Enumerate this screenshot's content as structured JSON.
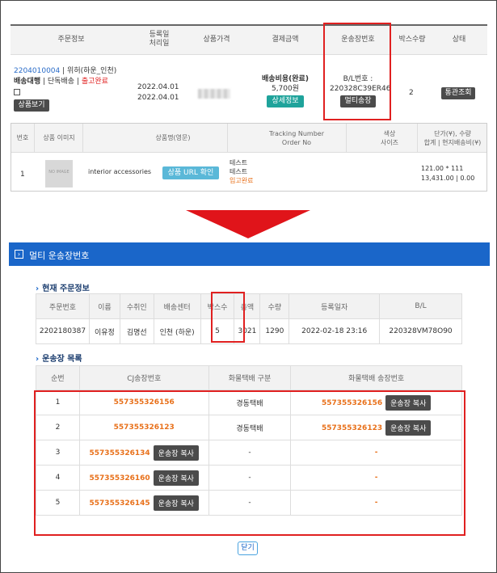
{
  "top_table": {
    "headers": [
      "주문정보",
      "등록일\n처리일",
      "상품가격",
      "결제금액",
      "운송장번호",
      "박스수량",
      "상태"
    ],
    "order": {
      "order_id": "2204010004",
      "order_name": "위허(하운_인천)",
      "agency": "배송대행",
      "single": "단독배송",
      "status_text": "출고완료",
      "view_button": "상품보기",
      "reg_date": "2022.04.01",
      "proc_date": "2022.04.01",
      "shipping_fee": "배송비용(완료)",
      "fee_amount": "5,700원",
      "detail_button": "상세정보",
      "bl_label": "B/L번호 :",
      "bl_number": "220328C39ER46",
      "multi_button": "멀티송장",
      "box_qty": "2",
      "customs_button": "통관조회"
    },
    "sub_headers": {
      "no": "번호",
      "image": "상품 이미지",
      "name": "상품명(영문)",
      "tracking": "Tracking Number\nOrder No",
      "color": "색상\n사이즈",
      "price": "단가(¥), 수량\n합계 | 현지배송비(¥)"
    },
    "item": {
      "no": "1",
      "thumb_text": "NO IMAGE",
      "name": "interior accessories",
      "url_button": "상품 URL 확인",
      "tracking1": "테스트",
      "tracking2": "테스트",
      "received": "입고완료",
      "price_line1": "121.00 * 111",
      "price_line2": "13,431.00 | 0.00"
    }
  },
  "modal": {
    "title": "멀티 운송장번호",
    "current_section": "현재 주문정보",
    "current_headers": [
      "주문번호",
      "이름",
      "수취인",
      "배송센터",
      "박스수",
      "총액",
      "수량",
      "등록일자",
      "B/L"
    ],
    "current_row": [
      "2202180387",
      "이유정",
      "김명선",
      "인천 (하운)",
      "5",
      "3021",
      "1290",
      "2022-02-18 23:16",
      "220328VM78O90"
    ],
    "list_section": "운송장 목록",
    "list_headers": [
      "순번",
      "CJ송장번호",
      "화물택배 구분",
      "화물택배 송장번호"
    ],
    "copy_label": "운송장 복사",
    "rows": [
      {
        "seq": "1",
        "cj": "557355326156",
        "cj_copy": false,
        "carrier": "경동택배",
        "cargo": "557355326156",
        "cargo_copy": true
      },
      {
        "seq": "2",
        "cj": "557355326123",
        "cj_copy": false,
        "carrier": "경동택배",
        "cargo": "557355326123",
        "cargo_copy": true
      },
      {
        "seq": "3",
        "cj": "557355326134",
        "cj_copy": true,
        "carrier": "-",
        "cargo": "-",
        "cargo_copy": false
      },
      {
        "seq": "4",
        "cj": "557355326160",
        "cj_copy": true,
        "carrier": "-",
        "cargo": "-",
        "cargo_copy": false
      },
      {
        "seq": "5",
        "cj": "557355326145",
        "cj_copy": true,
        "carrier": "-",
        "cargo": "-",
        "cargo_copy": false
      }
    ],
    "close_button": "닫기"
  },
  "colors": {
    "modal_bar": "#1a66c9",
    "highlight": "#e02020",
    "tracking": "#e8701a",
    "teal_button": "#1fa39b",
    "dark_button": "#4b4b4b"
  }
}
